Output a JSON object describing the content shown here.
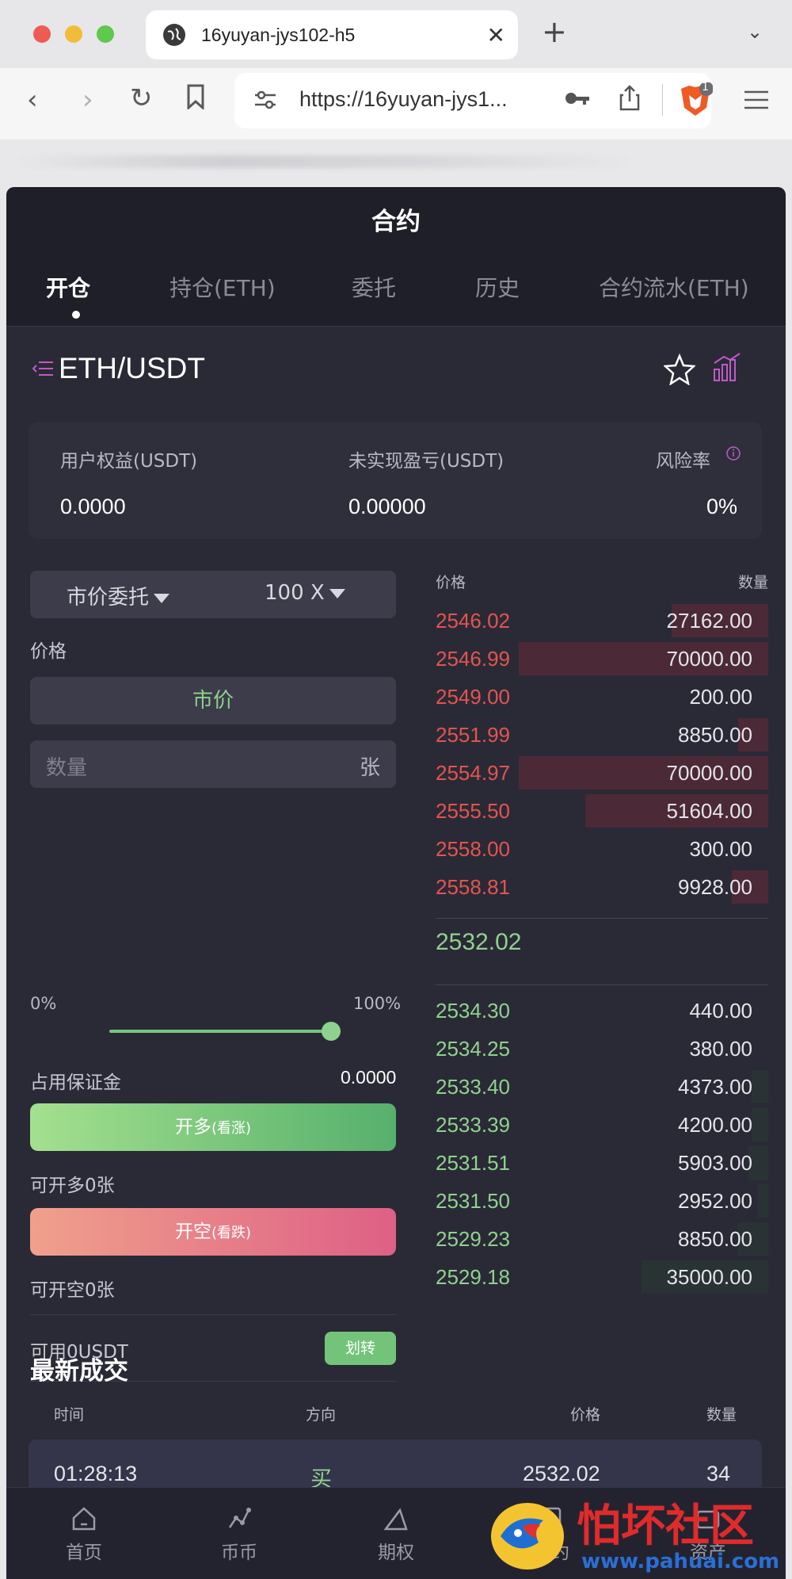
{
  "browser": {
    "tab_title": "16yuyan-jys102-h5",
    "url": "https://16yuyan-jys1...",
    "brave_badge": "1"
  },
  "app": {
    "title": "合约",
    "tabs": [
      "开仓",
      "持仓(ETH)",
      "委托",
      "历史",
      "合约流水(ETH)"
    ],
    "pair": "ETH/USDT",
    "stats": {
      "equity_label": "用户权益(USDT)",
      "equity_value": "0.0000",
      "pnl_label": "未实现盈亏(USDT)",
      "pnl_value": "0.00000",
      "risk_label": "风险率",
      "risk_value": "0%"
    },
    "order": {
      "type_label": "市价委托",
      "leverage": "100 X",
      "price_label": "价格",
      "market_label": "市价",
      "qty_placeholder": "数量",
      "qty_unit": "张",
      "pct_min": "0%",
      "pct_max": "100%",
      "slider_level": 1.0,
      "margin_label": "占用保证金",
      "margin_value": "0.0000",
      "long_btn": "开多",
      "long_sub": "(看涨)",
      "can_long": "可开多0张",
      "short_btn": "开空",
      "short_sub": "(看跌)",
      "can_short": "可开空0张",
      "available": "可用0USDT",
      "transfer_btn": "划转"
    },
    "book": {
      "price_header": "价格",
      "qty_header": "数量",
      "asks": [
        {
          "price": "2546.02",
          "qty": "27162.00",
          "depth": 0.29
        },
        {
          "price": "2546.99",
          "qty": "70000.00",
          "depth": 0.75
        },
        {
          "price": "2549.00",
          "qty": "200.00",
          "depth": 0.0
        },
        {
          "price": "2551.99",
          "qty": "8850.00",
          "depth": 0.09
        },
        {
          "price": "2554.97",
          "qty": "70000.00",
          "depth": 0.75
        },
        {
          "price": "2555.50",
          "qty": "51604.00",
          "depth": 0.55
        },
        {
          "price": "2558.00",
          "qty": "300.00",
          "depth": 0.0
        },
        {
          "price": "2558.81",
          "qty": "9928.00",
          "depth": 0.11
        }
      ],
      "last_price": "2532.02",
      "bids": [
        {
          "price": "2534.30",
          "qty": "440.00",
          "depth": 0.0
        },
        {
          "price": "2534.25",
          "qty": "380.00",
          "depth": 0.0
        },
        {
          "price": "2533.40",
          "qty": "4373.00",
          "depth": 0.05
        },
        {
          "price": "2533.39",
          "qty": "4200.00",
          "depth": 0.05
        },
        {
          "price": "2531.51",
          "qty": "5903.00",
          "depth": 0.06
        },
        {
          "price": "2531.50",
          "qty": "2952.00",
          "depth": 0.03
        },
        {
          "price": "2529.23",
          "qty": "8850.00",
          "depth": 0.09
        },
        {
          "price": "2529.18",
          "qty": "35000.00",
          "depth": 0.38
        }
      ]
    },
    "trades": {
      "title": "最新成交",
      "headers": {
        "time": "时间",
        "side": "方向",
        "price": "价格",
        "qty": "数量"
      },
      "rows": [
        {
          "time": "01:28:13",
          "side": "买",
          "price": "2532.02",
          "qty": "34"
        }
      ]
    },
    "nav": [
      "首页",
      "币币",
      "期权",
      "合约",
      "资产"
    ],
    "colors": {
      "up": "#8fd28e",
      "down": "#e3544f",
      "bg": "#2a2a36",
      "accent": "#c05ac8"
    }
  },
  "watermark": {
    "text": "怕坏社区",
    "url": "www.pahuai.com"
  }
}
